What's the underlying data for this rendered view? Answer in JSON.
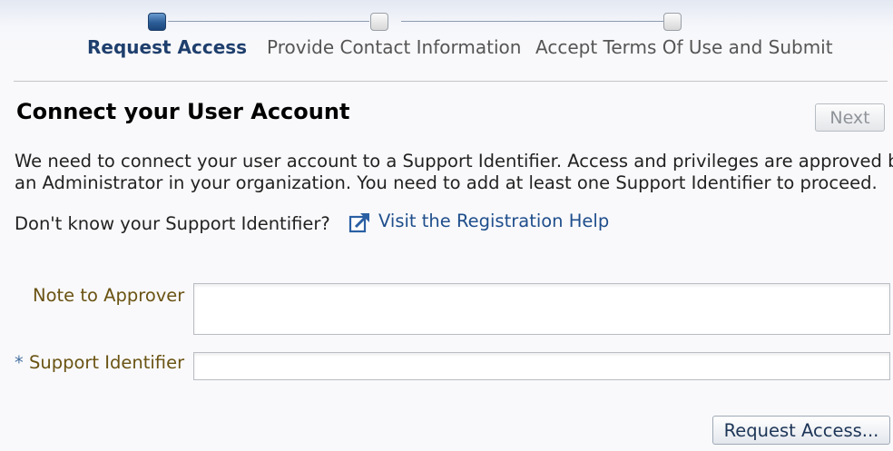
{
  "wizard": {
    "steps": [
      {
        "label": "Request Access",
        "state": "current"
      },
      {
        "label": "Provide Contact Information",
        "state": "pending"
      },
      {
        "label": "Accept Terms Of Use and Submit",
        "state": "pending"
      }
    ]
  },
  "header": {
    "title": "Connect your User Account",
    "next_label": "Next"
  },
  "description": {
    "line1": "We need to connect your user account to a Support Identifier. Access and privileges are approved by",
    "line2": "an Administrator in your organization. You need to add at least one Support Identifier to proceed."
  },
  "help": {
    "question": "Don't know your Support Identifier?",
    "link_text": "Visit the Registration Help",
    "link_icon": "external-link-icon"
  },
  "form": {
    "note_label": "Note to Approver",
    "note_value": "",
    "support_id_required_marker": "*",
    "support_id_label": "Support Identifier",
    "support_id_value": ""
  },
  "actions": {
    "request_access_label": "Request Access..."
  },
  "colors": {
    "active_step": "#1f3f6d",
    "link": "#1f4e8c",
    "field_label": "#6a5313"
  }
}
